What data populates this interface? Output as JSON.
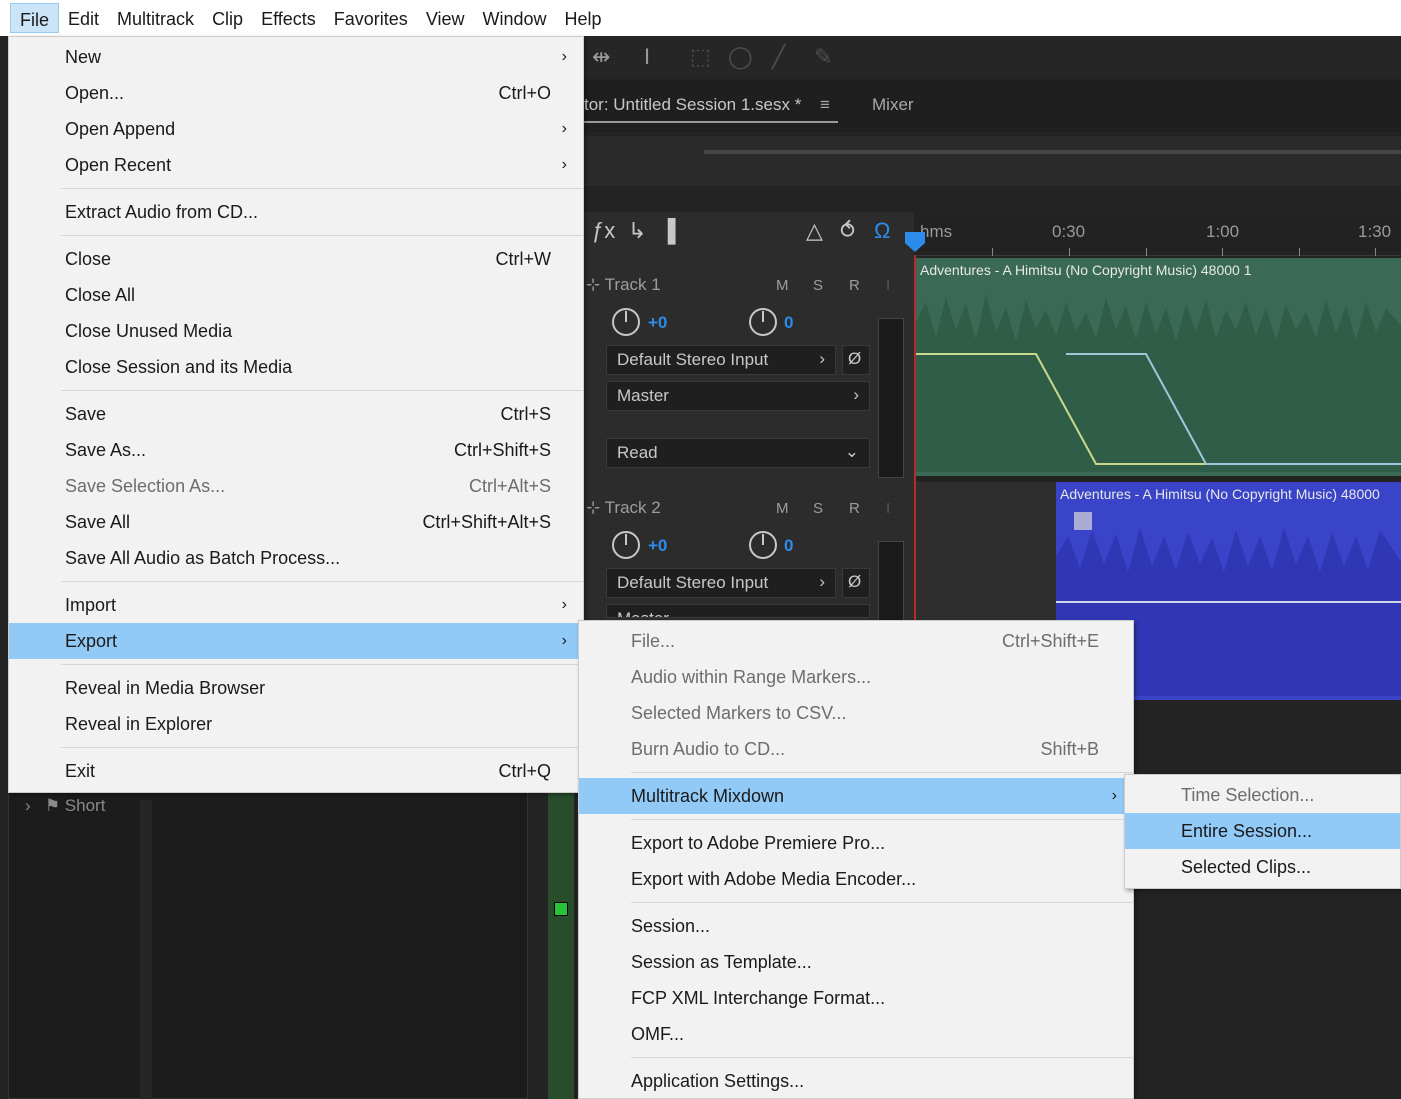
{
  "menubar": [
    "File",
    "Edit",
    "Multitrack",
    "Clip",
    "Effects",
    "Favorites",
    "View",
    "Window",
    "Help"
  ],
  "editor": {
    "session_tab": "tor: Untitled Session 1.sesx *",
    "menu_icon": "≡",
    "mixer_tab": "Mixer"
  },
  "ruler": {
    "unit": "hms",
    "t1": "0:30",
    "t2": "1:00",
    "t3": "1:30"
  },
  "tracks": [
    {
      "name": "Track 1",
      "m": "M",
      "s": "S",
      "r": "R",
      "i": "I",
      "volume": "+0",
      "pan": "0",
      "input": "Default Stereo Input",
      "output": "Master",
      "automation": "Read",
      "clip": "Adventures - A Himitsu (No Copyright Music) 48000 1"
    },
    {
      "name": "Track 2",
      "m": "M",
      "s": "S",
      "r": "R",
      "i": "I",
      "volume": "+0",
      "pan": "0",
      "input": "Default Stereo Input",
      "output": "Master",
      "clip": "Adventures - A Himitsu (No Copyright Music) 48000"
    }
  ],
  "lower_panel": {
    "item": "Short"
  },
  "file_menu": {
    "new": "New",
    "open": "Open...",
    "open_sc": "Ctrl+O",
    "open_append": "Open Append",
    "open_recent": "Open Recent",
    "extract": "Extract Audio from CD...",
    "close": "Close",
    "close_sc": "Ctrl+W",
    "close_all": "Close All",
    "close_unused": "Close Unused Media",
    "close_session": "Close Session and its Media",
    "save": "Save",
    "save_sc": "Ctrl+S",
    "save_as": "Save As...",
    "save_as_sc": "Ctrl+Shift+S",
    "save_sel": "Save Selection As...",
    "save_sel_sc": "Ctrl+Alt+S",
    "save_all": "Save All",
    "save_all_sc": "Ctrl+Shift+Alt+S",
    "save_batch": "Save All Audio as Batch Process...",
    "import": "Import",
    "export": "Export",
    "reveal_browser": "Reveal in Media Browser",
    "reveal_explorer": "Reveal in Explorer",
    "exit": "Exit",
    "exit_sc": "Ctrl+Q"
  },
  "export_menu": {
    "file": "File...",
    "file_sc": "Ctrl+Shift+E",
    "range": "Audio within Range Markers...",
    "markers_csv": "Selected Markers to CSV...",
    "burn": "Burn Audio to CD...",
    "burn_sc": "Shift+B",
    "mixdown": "Multitrack Mixdown",
    "premiere": "Export to Adobe Premiere Pro...",
    "encoder": "Export with Adobe Media Encoder...",
    "session": "Session...",
    "template": "Session as Template...",
    "fcp": "FCP XML Interchange Format...",
    "omf": "OMF...",
    "app_settings": "Application Settings..."
  },
  "mixdown_menu": {
    "time_selection": "Time Selection...",
    "entire_session": "Entire Session...",
    "selected_clips": "Selected Clips..."
  },
  "icons": {
    "arrow": "›"
  },
  "colors": {
    "menu_highlight": "#91c9f7",
    "clip1": "#3a6a55",
    "clip2": "#3a44c8",
    "accent": "#2d8ceb"
  }
}
